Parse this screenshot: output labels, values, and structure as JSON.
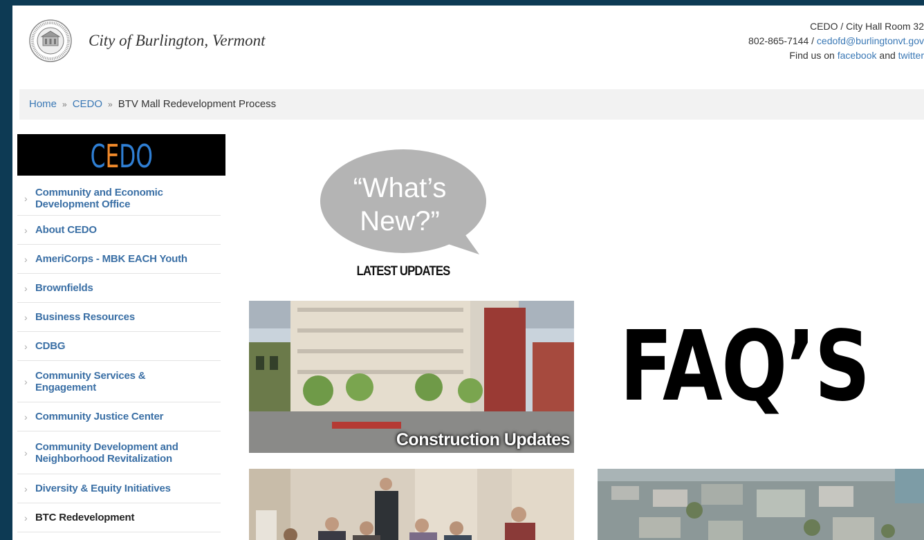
{
  "header": {
    "city_title": "City of Burlington, Vermont",
    "contact": {
      "line1": "CEDO / City Hall Room 32",
      "phone": "802-865-7144",
      "slash": " / ",
      "email": "cedofd@burlingtonvt.gov",
      "find_prefix": "Find us on ",
      "facebook": "facebook",
      "and": " and ",
      "twitter": "twitter"
    }
  },
  "breadcrumb": {
    "home": "Home",
    "sep": "»",
    "cedo": "CEDO",
    "current": "BTV Mall Redevelopment Process"
  },
  "sidebar": {
    "banner_text": "CEDO",
    "items": [
      {
        "label_line1": "Community and Economic",
        "label_line2": "Development Office"
      },
      {
        "label_line1": "About CEDO",
        "label_line2": ""
      },
      {
        "label_line1": "AmeriCorps - MBK EACH Youth",
        "label_line2": ""
      },
      {
        "label_line1": "Brownfields",
        "label_line2": ""
      },
      {
        "label_line1": "Business Resources",
        "label_line2": ""
      },
      {
        "label_line1": "CDBG",
        "label_line2": ""
      },
      {
        "label_line1": "Community Services &",
        "label_line2": "Engagement"
      },
      {
        "label_line1": "Community Justice Center",
        "label_line2": ""
      },
      {
        "label_line1": "Community Development and",
        "label_line2": "Neighborhood Revitalization"
      },
      {
        "label_line1": "Diversity & Equity Initiatives",
        "label_line2": ""
      },
      {
        "label_line1": "BTC Redevelopment",
        "label_line2": ""
      }
    ],
    "chevron": "›"
  },
  "main": {
    "whats_new_line1": "“What’s",
    "whats_new_line2": "New?”",
    "latest_updates": "LATEST UPDATES",
    "construction_label": "Construction Updates",
    "faq_text": "FAQ’S"
  },
  "colors": {
    "frame": "#0d3a54",
    "link": "#3a78b5",
    "cedo_blue": "#2f7fd4",
    "cedo_orange": "#f0892a"
  }
}
